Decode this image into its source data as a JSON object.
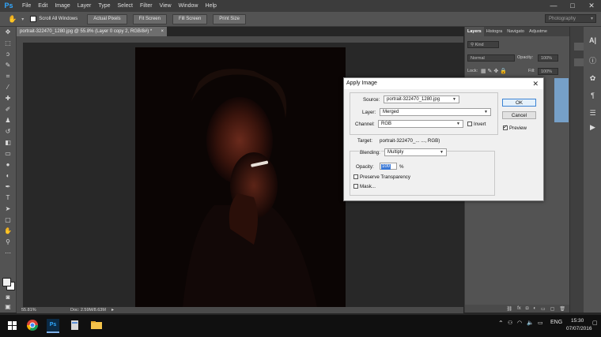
{
  "app": {
    "name": "Ps"
  },
  "menu": {
    "items": [
      "File",
      "Edit",
      "Image",
      "Layer",
      "Type",
      "Select",
      "Filter",
      "View",
      "Window",
      "Help"
    ]
  },
  "window_controls": {
    "minimize": "—",
    "maximize": "□",
    "close": "✕"
  },
  "options_bar": {
    "scroll_all": "Scroll All Windows",
    "buttons": [
      "Actual Pixels",
      "Fit Screen",
      "Fill Screen",
      "Print Size"
    ],
    "workspace": "Photography"
  },
  "document": {
    "tab_title": "portrait-322470_1280.jpg @ 55.8% (Layer 0 copy 2, RGB/8#) *",
    "zoom": "55.81%",
    "doc_size": "Doc: 2.59M/8.63M"
  },
  "panels": {
    "tabs": [
      "Layers",
      "Histogra",
      "Navigato",
      "Adjustme"
    ],
    "kind": "Kind",
    "blend": "Normal",
    "opacity_label": "Opacity:",
    "opacity_value": "100%",
    "lock_label": "Lock:",
    "fill_label": "Fill:",
    "fill_value": "100%"
  },
  "dialog": {
    "title": "Apply Image",
    "source_label": "Source:",
    "source_value": "portrait-322470_1280.jpg",
    "layer_label": "Layer:",
    "layer_value": "Merged",
    "channel_label": "Channel:",
    "channel_value": "RGB",
    "invert_label": "Invert",
    "target_label": "Target:",
    "target_value": "portrait-322470_... ..., RGB)",
    "blending_label": "Blending:",
    "blending_value": "Multiply",
    "opacity_label": "Opacity:",
    "opacity_value": "100",
    "percent": "%",
    "preserve_label": "Preserve Transparency",
    "mask_label": "Mask...",
    "ok": "OK",
    "cancel": "Cancel",
    "preview_label": "Preview",
    "preview_checked": true,
    "invert_checked": false,
    "preserve_checked": false,
    "mask_checked": false
  },
  "taskbar": {
    "lang": "ENG",
    "time": "15:30",
    "date": "07/07/2016"
  }
}
